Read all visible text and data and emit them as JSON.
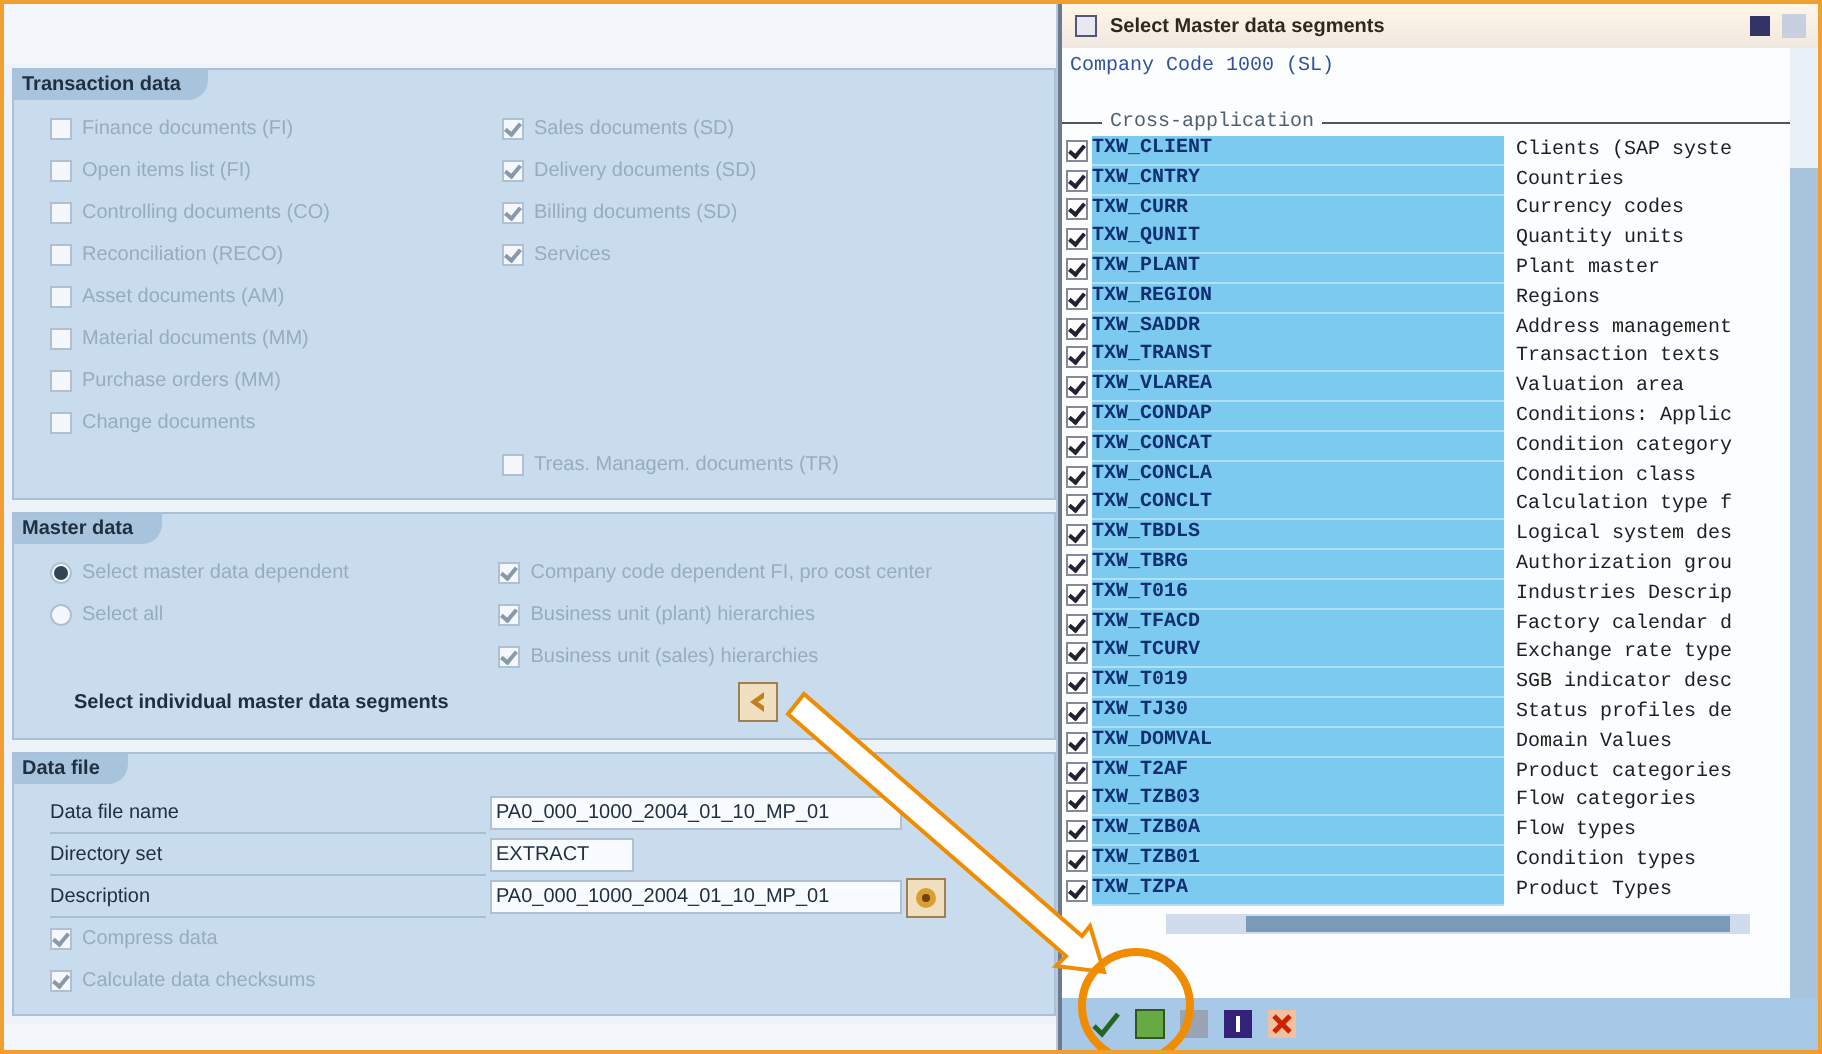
{
  "transaction_data": {
    "title": "Transaction data",
    "left": [
      {
        "label": "Finance documents (FI)",
        "checked": false,
        "disabled": true
      },
      {
        "label": "Open items list (FI)",
        "checked": false,
        "disabled": true
      },
      {
        "label": "Controlling documents (CO)",
        "checked": false,
        "disabled": true
      },
      {
        "label": "Reconciliation (RECO)",
        "checked": false,
        "disabled": true
      },
      {
        "label": "Asset documents (AM)",
        "checked": false,
        "disabled": true
      },
      {
        "label": "Material documents (MM)",
        "checked": false,
        "disabled": true
      },
      {
        "label": "Purchase orders (MM)",
        "checked": false,
        "disabled": true
      },
      {
        "label": "Change documents",
        "checked": false,
        "disabled": true
      }
    ],
    "right": [
      {
        "label": "Sales documents (SD)",
        "checked": true,
        "disabled": true
      },
      {
        "label": "Delivery documents (SD)",
        "checked": true,
        "disabled": true
      },
      {
        "label": "Billing documents (SD)",
        "checked": true,
        "disabled": true
      },
      {
        "label": "Services",
        "checked": true,
        "disabled": true
      },
      {
        "label": "Treas. Managem. documents (TR)",
        "checked": false,
        "disabled": true
      }
    ]
  },
  "master_data": {
    "title": "Master data",
    "radios": [
      {
        "label": "Select master data dependent",
        "selected": true
      },
      {
        "label": "Select all",
        "selected": false
      }
    ],
    "options": [
      {
        "label": "Company code dependent FI, pro cost center",
        "checked": true,
        "disabled": true
      },
      {
        "label": "Business unit (plant) hierarchies",
        "checked": true,
        "disabled": true
      },
      {
        "label": "Business unit (sales) hierarchies",
        "checked": true,
        "disabled": true
      }
    ],
    "segments_label": "Select individual master data segments"
  },
  "data_file": {
    "title": "Data file",
    "fields": [
      {
        "label": "Data file name",
        "value": "PA0_000_1000_2004_01_10_MP_01",
        "kind": "wide"
      },
      {
        "label": "Directory set",
        "value": "EXTRACT",
        "kind": "short"
      },
      {
        "label": "Description",
        "value": "PA0_000_1000_2004_01_10_MP_01",
        "kind": "lookup"
      }
    ],
    "options": [
      {
        "label": "Compress data",
        "checked": true,
        "disabled": true
      },
      {
        "label": "Calculate data checksums",
        "checked": true,
        "disabled": true
      }
    ]
  },
  "dialog": {
    "title": "Select Master data segments",
    "subtitle": "Company Code 1000 (SL)",
    "group": "Cross-application",
    "rows": [
      {
        "name": "TXW_CLIENT",
        "description": "Clients (SAP syste",
        "checked": true
      },
      {
        "name": "TXW_CNTRY",
        "description": "Countries",
        "checked": true
      },
      {
        "name": "TXW_CURR",
        "description": "Currency codes",
        "checked": true
      },
      {
        "name": "TXW_QUNIT",
        "description": "Quantity units",
        "checked": true
      },
      {
        "name": "TXW_PLANT",
        "description": "Plant master",
        "checked": true
      },
      {
        "name": "TXW_REGION",
        "description": "Regions",
        "checked": true
      },
      {
        "name": "TXW_SADDR",
        "description": "Address management",
        "checked": true
      },
      {
        "name": "TXW_TRANST",
        "description": "Transaction texts",
        "checked": true
      },
      {
        "name": "TXW_VLAREA",
        "description": "Valuation area",
        "checked": true
      },
      {
        "name": "TXW_CONDAP",
        "description": "Conditions: Applic",
        "checked": true
      },
      {
        "name": "TXW_CONCAT",
        "description": "Condition category",
        "checked": true
      },
      {
        "name": "TXW_CONCLA",
        "description": "Condition class",
        "checked": true
      },
      {
        "name": "TXW_CONCLT",
        "description": "Calculation type f",
        "checked": true
      },
      {
        "name": "TXW_TBDLS",
        "description": "Logical system des",
        "checked": true
      },
      {
        "name": "TXW_TBRG",
        "description": "Authorization grou",
        "checked": true
      },
      {
        "name": "TXW_T016",
        "description": "Industries Descrip",
        "checked": true
      },
      {
        "name": "TXW_TFACD",
        "description": "Factory calendar d",
        "checked": true
      },
      {
        "name": "TXW_TCURV",
        "description": "Exchange rate type",
        "checked": true
      },
      {
        "name": "TXW_T019",
        "description": "SGB indicator desc",
        "checked": true
      },
      {
        "name": "TXW_TJ30",
        "description": "Status profiles de",
        "checked": true
      },
      {
        "name": "TXW_DOMVAL",
        "description": "Domain Values",
        "checked": true
      },
      {
        "name": "TXW_T2AF",
        "description": "Product categories",
        "checked": true
      },
      {
        "name": "TXW_TZB03",
        "description": "Flow categories",
        "checked": true
      },
      {
        "name": "TXW_TZB0A",
        "description": "Flow types",
        "checked": true
      },
      {
        "name": "TXW_TZB01",
        "description": "Condition types",
        "checked": true
      },
      {
        "name": "TXW_TZPA",
        "description": "Product Types",
        "checked": true
      }
    ]
  }
}
